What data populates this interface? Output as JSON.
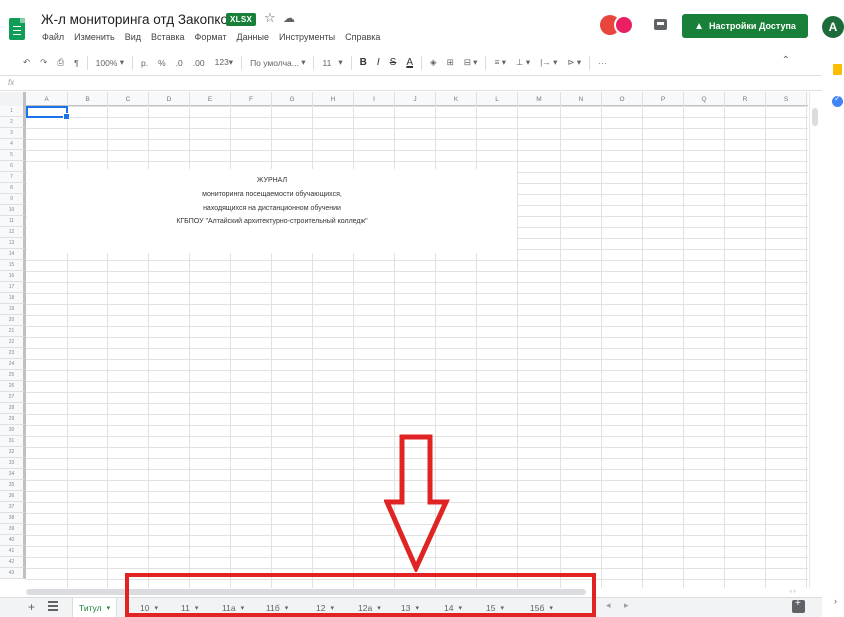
{
  "header": {
    "title": "Ж-л мониторинга отд Закопко",
    "file_badge": "XLSX",
    "menu": [
      "Файл",
      "Изменить",
      "Вид",
      "Вставка",
      "Формат",
      "Данные",
      "Инструменты",
      "Справка"
    ],
    "share_label": "Настройки Доступа",
    "user_initial": "A"
  },
  "toolbar": {
    "zoom": "100%",
    "currency": "р.",
    "percent": "%",
    "decimal_decrease": ".0",
    "decimal_increase": ".00",
    "number_format": "123▾",
    "font": "По умолча...",
    "font_size": "11",
    "bold": "B",
    "italic": "I",
    "strike": "S",
    "text_color": "A",
    "more": "···"
  },
  "grid": {
    "columns": [
      "A",
      "B",
      "C",
      "D",
      "E",
      "F",
      "G",
      "H",
      "I",
      "J",
      "K",
      "L",
      "M",
      "N",
      "O",
      "P",
      "Q",
      "R",
      "S"
    ],
    "row_count": 43,
    "journal": {
      "line1": "ЖУРНАЛ",
      "line2": "мониторинга посещаемости обучающихся,",
      "line3": "находящихся на дистанционном обучении",
      "line4": "КГБПОУ \"Алтайский архитектурно-строительный колледж\""
    }
  },
  "sheets": {
    "active": "Титул",
    "tabs": [
      "10",
      "11",
      "11а",
      "11б",
      "12",
      "12а",
      "13",
      "14",
      "15",
      "15б"
    ]
  },
  "colors": {
    "brand_green": "#188038",
    "annotation_red": "#e02424",
    "selection_blue": "#1a73e8"
  }
}
